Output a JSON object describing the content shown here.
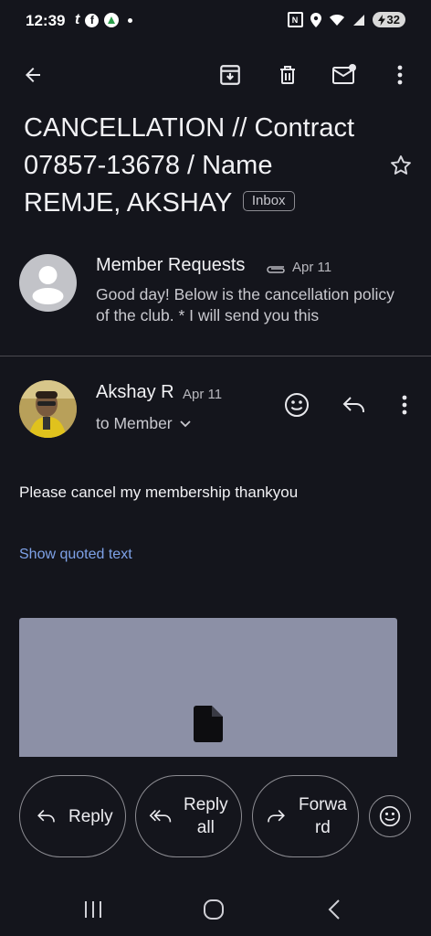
{
  "status_bar": {
    "time": "12:39",
    "battery": "32"
  },
  "email": {
    "subject": "CANCELLATION // Contract 07857-13678 / Name REMJE, AKSHAY",
    "label": "Inbox"
  },
  "message1": {
    "sender": "Member Requests",
    "date": "Apr 11",
    "snippet": "Good day! Below is the cancellation policy of the club. * I will send you this"
  },
  "message2": {
    "sender": "Akshay R",
    "date": "Apr 11",
    "to": "to Member",
    "body": "Please cancel my membership thankyou",
    "show_quoted": "Show quoted text"
  },
  "actions": {
    "reply": "Reply",
    "reply_all_line1": "Reply",
    "reply_all_line2": "all",
    "forward_line1": "Forwa",
    "forward_line2": "rd"
  },
  "colors": {
    "background": "#14151c",
    "link": "#7ea2e8",
    "attachment_preview": "#8c90a6"
  }
}
